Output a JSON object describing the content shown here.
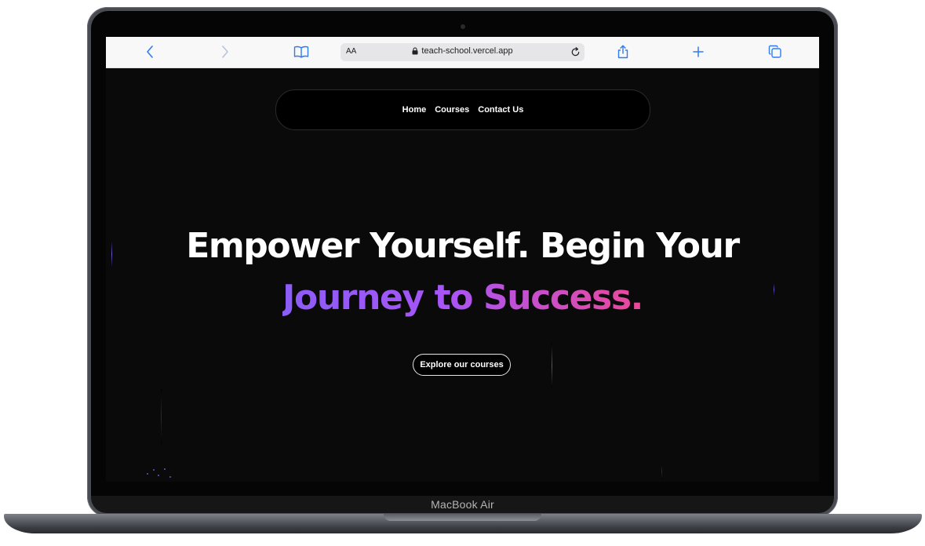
{
  "browser": {
    "aa_label": "AA",
    "url": "teach-school.vercel.app",
    "icons": [
      "chevron-left-icon",
      "chevron-right-icon",
      "book-icon",
      "lock-icon",
      "reload-icon",
      "share-icon",
      "plus-icon",
      "tabs-icon"
    ],
    "accent_color": "#2f7bf5"
  },
  "nav": {
    "items": [
      "Home",
      "Courses",
      "Contact Us"
    ]
  },
  "hero": {
    "line1": "Empower Yourself. Begin Your",
    "line2": "Journey to Success.",
    "gradient": [
      "#8b5cf6",
      "#a855f7",
      "#ec4899"
    ]
  },
  "cta": {
    "label": "Explore our courses"
  },
  "device": {
    "model": "MacBook Air"
  }
}
